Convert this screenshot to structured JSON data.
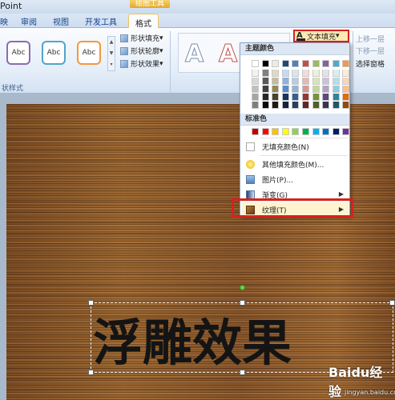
{
  "title_bar": {
    "app_title": "Point",
    "contextual_header": "绘图工具"
  },
  "tabs": [
    {
      "label": "映"
    },
    {
      "label": "审阅"
    },
    {
      "label": "视图"
    },
    {
      "label": "开发工具"
    },
    {
      "label": "格式"
    }
  ],
  "shape_styles": {
    "group_label": "状样式",
    "presets": [
      {
        "label": "Abc",
        "border_color": "#8a6bb5"
      },
      {
        "label": "Abc",
        "border_color": "#4fa5c8"
      },
      {
        "label": "Abc",
        "border_color": "#f39a3a"
      }
    ],
    "fill_label": "形状填充",
    "outline_label": "形状轮廓",
    "effects_label": "形状效果"
  },
  "wordart": {
    "text_fill_label": "文本填充",
    "letters": [
      "A",
      "A"
    ]
  },
  "arrange": {
    "bring_forward": "上移一层",
    "send_backward": "下移一层",
    "selection_pane": "选择窗格"
  },
  "dropdown": {
    "theme_colors_header": "主题颜色",
    "standard_colors_header": "标准色",
    "theme_colors": [
      [
        "#ffffff",
        "#000000",
        "#eeece1",
        "#1f497d",
        "#4f81bd",
        "#c0504d",
        "#9bbb59",
        "#8064a2",
        "#4bacc6",
        "#f79646"
      ],
      [
        "#f2f2f2",
        "#7f7f7f",
        "#ddd9c3",
        "#c6d9f0",
        "#dbe5f1",
        "#f2dcdb",
        "#ebf1dd",
        "#e5e0ec",
        "#dbeef3",
        "#fdeada"
      ],
      [
        "#d8d8d8",
        "#595959",
        "#c4bd97",
        "#8db3e2",
        "#b8cce4",
        "#e5b9b7",
        "#d7e3bc",
        "#ccc1d9",
        "#b7dde8",
        "#fbd5b5"
      ],
      [
        "#bfbfbf",
        "#3f3f3f",
        "#938953",
        "#548dd4",
        "#95b3d7",
        "#d99694",
        "#c3d69b",
        "#b2a2c7",
        "#92cddc",
        "#fac08f"
      ],
      [
        "#a5a5a5",
        "#262626",
        "#494429",
        "#17365d",
        "#366092",
        "#953734",
        "#76923c",
        "#5f497a",
        "#31859b",
        "#e36c09"
      ],
      [
        "#7f7f7f",
        "#0c0c0c",
        "#1d1b10",
        "#0f243e",
        "#244061",
        "#632423",
        "#4f6128",
        "#3f3151",
        "#205867",
        "#974806"
      ]
    ],
    "standard_colors": [
      "#c00000",
      "#ff0000",
      "#ffc000",
      "#ffff00",
      "#92d050",
      "#00b050",
      "#00b0f0",
      "#0070c0",
      "#002060",
      "#7030a0"
    ],
    "no_fill": "无填充颜色(N)",
    "more_colors": "其他填充颜色(M)...",
    "picture": "图片(P)...",
    "gradient": "渐变(G)",
    "texture": "纹理(T)"
  },
  "slide": {
    "text": "浮雕效果"
  },
  "watermark": {
    "logo": "Baidu经验",
    "url": "jingyan.baidu.com"
  }
}
